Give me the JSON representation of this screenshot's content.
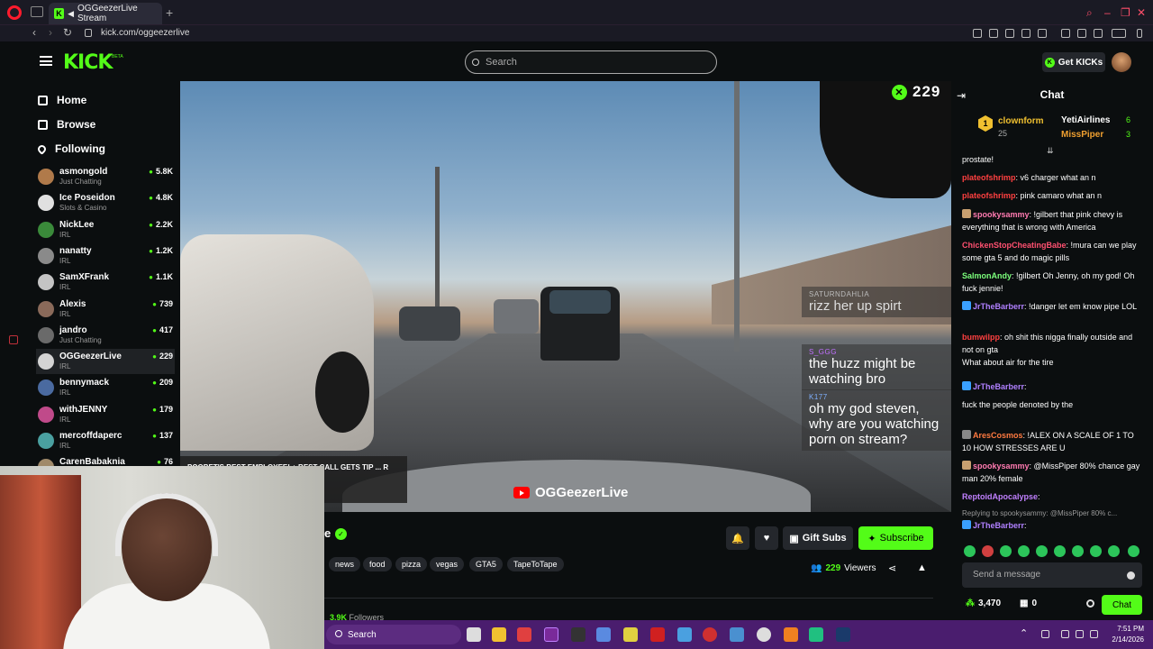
{
  "browser": {
    "tab_title": "OGGeezerLive Stream",
    "tab_favicon": "K",
    "url": "kick.com/oggeezerlive",
    "new_tab": "+"
  },
  "header": {
    "logo": "KICK",
    "beta": "BETA",
    "search_placeholder": "Search",
    "get_kicks": "Get KICKs",
    "kicks_icon": "K"
  },
  "sidebar": {
    "nav": [
      {
        "label": "Home"
      },
      {
        "label": "Browse"
      },
      {
        "label": "Following"
      }
    ],
    "channels": [
      {
        "name": "asmongold",
        "category": "Just Chatting",
        "viewers": "5.8K",
        "color": "#b07a4a"
      },
      {
        "name": "Ice Poseidon",
        "category": "Slots & Casino",
        "viewers": "4.8K",
        "color": "#e0e0e0"
      },
      {
        "name": "NickLee",
        "category": "IRL",
        "viewers": "2.2K",
        "color": "#3a8a3a"
      },
      {
        "name": "nanatty",
        "category": "IRL",
        "viewers": "1.2K",
        "color": "#8a8a8a"
      },
      {
        "name": "SamXFrank",
        "category": "IRL",
        "viewers": "1.1K",
        "color": "#c4c4c4"
      },
      {
        "name": "Alexis",
        "category": "IRL",
        "viewers": "739",
        "color": "#8a6a5a"
      },
      {
        "name": "jandro",
        "category": "Just Chatting",
        "viewers": "417",
        "color": "#6a6a6a"
      },
      {
        "name": "OGGeezerLive",
        "category": "IRL",
        "viewers": "229",
        "color": "#d4d4d4"
      },
      {
        "name": "bennymack",
        "category": "IRL",
        "viewers": "209",
        "color": "#4a6aa0"
      },
      {
        "name": "withJENNY",
        "category": "IRL",
        "viewers": "179",
        "color": "#c04a8a"
      },
      {
        "name": "mercoffdaperc",
        "category": "IRL",
        "viewers": "137",
        "color": "#4aa0a0"
      },
      {
        "name": "CarenBabaknia",
        "category": "",
        "viewers": "76",
        "color": "#a08a6a"
      }
    ]
  },
  "video": {
    "viewer_overlay": "229",
    "watermark_channel": "OGGeezerLive",
    "overlay_messages": [
      {
        "user": "SATURNDAHLIA",
        "text": "rizz her up spirt",
        "user_color": "#bbbbbb"
      },
      {
        "user": "S_GGG",
        "text": "the huzz might be watching bro",
        "user_color": "#c070ff"
      },
      {
        "user": "K177",
        "text": "oh my god steven, why are you watching porn on stream?",
        "user_color": "#7fb0ff"
      }
    ],
    "donation_banner": "POOBET'S BEST EMPLOYEE! + BEST CALL GETS TIP ... R TONS OF ... ls !twitch"
  },
  "stream_info": {
    "name_fragment": "e",
    "verified_icon": "✓",
    "tags": [
      "news",
      "food",
      "pizza",
      "vegas",
      "GTA5",
      "TapeToTape"
    ],
    "gift_subs": "Gift Subs",
    "subscribe": "Subscribe",
    "viewers_count": "229",
    "viewers_label": "Viewers",
    "followers_count": "3.9K",
    "followers_label": "Followers"
  },
  "chat": {
    "title": "Chat",
    "leaderboard": {
      "first": {
        "rank": "1",
        "name": "clownform",
        "count": "25"
      },
      "second": {
        "name": "YetiAirlines",
        "count": "6"
      },
      "third": {
        "name": "MissPiper",
        "count": "3"
      }
    },
    "messages": [
      {
        "user": "",
        "text": "prostate!",
        "color": "#ffffff",
        "badge": ""
      },
      {
        "user": "plateofshrimp",
        "text": ": v6 charger what an n",
        "color": "#ff4040",
        "badge": ""
      },
      {
        "user": "plateofshrimp",
        "text": ": pink camaro what an n",
        "color": "#ff4040",
        "badge": ""
      },
      {
        "user": "spookysammy",
        "text": ": !gilbert that pink chevy is everything that is wrong with America",
        "color": "#ff7ab0",
        "badge": "#c8a070"
      },
      {
        "user": "ChickenStopCheatingBabe",
        "text": ": !mura can we play some gta 5 and do magic pills",
        "color": "#ff5070",
        "badge": ""
      },
      {
        "user": "SalmonAndy",
        "text": ": !gilbert Oh Jenny, oh my god! Oh fuck jennie!",
        "color": "#7cff7c",
        "badge": ""
      },
      {
        "user": "JrTheBarberr",
        "text": ": !danger let em know pipe LOL",
        "color": "#b080ff",
        "badge": "#3aa0ff"
      },
      {
        "user": "bumwilpp",
        "text": ": oh shit this nigga finally outside and not on gta",
        "color": "#ff4040",
        "badge": ""
      },
      {
        "user": "",
        "text": "What about air for the tire",
        "color": "#ffffff",
        "badge": ""
      },
      {
        "user": "JrTheBarberr",
        "text": ":",
        "color": "#b080ff",
        "badge": "#3aa0ff"
      },
      {
        "user": "",
        "text": "fuck the people denoted by the",
        "color": "#ffffff",
        "badge": ""
      },
      {
        "user": "AresCosmos",
        "text": ": !ALEX ON A SCALE OF 1 TO 10 HOW STRESSES ARE U",
        "color": "#ff7a40",
        "badge": "#888888"
      },
      {
        "user": "spookysammy",
        "text": ": @MissPiper 80% chance gay man 20% female",
        "color": "#ff7ab0",
        "badge": "#c8a070"
      },
      {
        "user": "ReptoidApocalypse",
        "text": ":",
        "color": "#c080ff",
        "badge": ""
      },
      {
        "user": "",
        "text": "Replying to spookysammy: @MissPiper 80% c...",
        "color": "#999999",
        "badge": ""
      },
      {
        "user": "JrTheBarberr",
        "text": ":",
        "color": "#b080ff",
        "badge": "#3aa0ff"
      }
    ],
    "input_placeholder": "Send a message",
    "kicks_balance": "3,470",
    "other_count": "0",
    "send_label": "Chat"
  },
  "taskbar": {
    "search": "Search",
    "time": "7:51 PM",
    "date": "2/14/2026"
  }
}
